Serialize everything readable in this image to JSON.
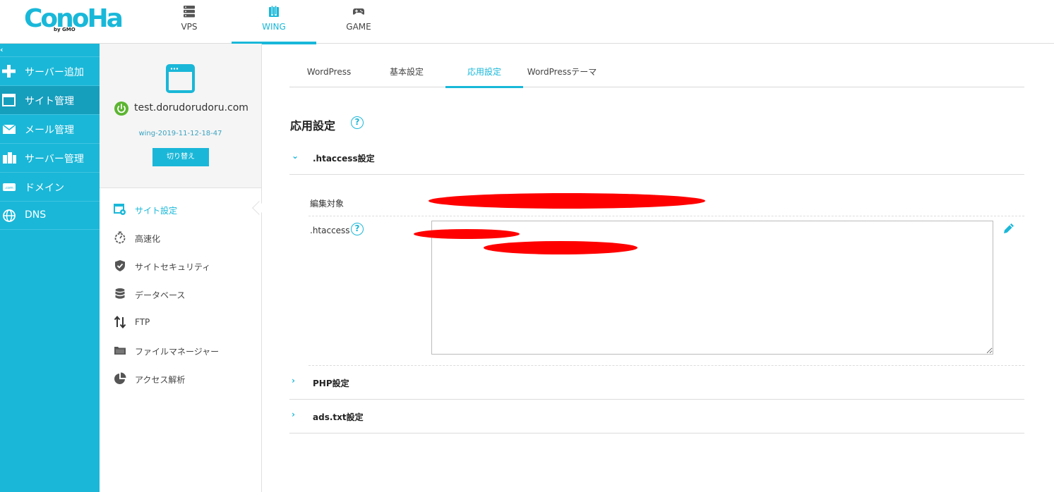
{
  "brand": {
    "name": "ConoHa",
    "sub": "by GMO",
    "color": "#19b8d9"
  },
  "topnav": [
    {
      "label": "VPS",
      "icon": "server-icon"
    },
    {
      "label": "WING",
      "icon": "wing-icon",
      "active": true
    },
    {
      "label": "GAME",
      "icon": "gamepad-icon"
    }
  ],
  "sidebar": {
    "items": [
      {
        "label": "サーバー追加",
        "icon": "plus-icon"
      },
      {
        "label": "サイト管理",
        "icon": "window-icon",
        "active": true
      },
      {
        "label": "メール管理",
        "icon": "mail-icon"
      },
      {
        "label": "サーバー管理",
        "icon": "server-stack-icon"
      },
      {
        "label": "ドメイン",
        "icon": "domain-icon"
      },
      {
        "label": "DNS",
        "icon": "globe-icon"
      }
    ]
  },
  "site": {
    "domain": "test.dorudorudoru.com",
    "id": "wing-2019-11-12-18-47",
    "switch_label": "切り替え",
    "status_color": "#5cb531"
  },
  "submenu": {
    "items": [
      {
        "label": "サイト設定",
        "icon": "site-settings-icon",
        "active": true
      },
      {
        "label": "高速化",
        "icon": "stopwatch-icon"
      },
      {
        "label": "サイトセキュリティ",
        "icon": "shield-icon"
      },
      {
        "label": "データベース",
        "icon": "database-icon"
      },
      {
        "label": "FTP",
        "icon": "transfer-arrows-icon"
      },
      {
        "label": "ファイルマネージャー",
        "icon": "folder-icon"
      },
      {
        "label": "アクセス解析",
        "icon": "pie-chart-icon"
      }
    ]
  },
  "tabs": [
    {
      "label": "WordPress"
    },
    {
      "label": "基本設定"
    },
    {
      "label": "応用設定",
      "active": true
    },
    {
      "label": "WordPressテーマ"
    }
  ],
  "page": {
    "title": "応用設定",
    "sections": {
      "htaccess": {
        "title": ".htaccess設定",
        "expanded": true
      },
      "php": {
        "title": "PHP設定",
        "expanded": false
      },
      "adstxt": {
        "title": "ads.txt設定",
        "expanded": false
      }
    },
    "fields": {
      "target_label": "編集対象",
      "htaccess_label": ".htaccess"
    }
  }
}
